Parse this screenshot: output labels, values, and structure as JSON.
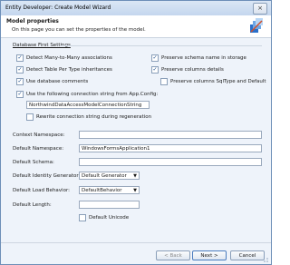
{
  "window": {
    "title": "Entity Developer: Create Model Wizard",
    "close": "×"
  },
  "header": {
    "title": "Model properties",
    "subtitle": "On this page you can set the properties of the model."
  },
  "db_first": {
    "section_label": "Database First Settings",
    "options": {
      "detect_m2m": {
        "label": "Detect Many-to-Many associations",
        "checked": true
      },
      "preserve_schema": {
        "label": "Preserve schema name in storage",
        "checked": true
      },
      "detect_tpt": {
        "label": "Detect Table Per Type inheritances",
        "checked": true
      },
      "preserve_columns": {
        "label": "Preserve columns details",
        "checked": true
      },
      "use_comments": {
        "label": "Use database comments",
        "checked": true
      },
      "preserve_sqltype": {
        "label": "Preserve columns SqlType and Default",
        "checked": false
      },
      "use_connstr": {
        "label": "Use the following connection string from App.Config:",
        "checked": true
      },
      "rewrite": {
        "label": "Rewrite connection string during regeneration",
        "checked": false
      }
    },
    "connection_string": "NorthwindDataAccessModelConnectionString"
  },
  "fields": {
    "context_namespace": {
      "label": "Context Namespace:",
      "value": ""
    },
    "default_namespace": {
      "label": "Default Namespace:",
      "value": "WindowsFormsApplication1"
    },
    "default_schema": {
      "label": "Default Schema:",
      "value": ""
    },
    "identity_generator": {
      "label": "Default Identity Generator:",
      "value": "Default Generator"
    },
    "load_behavior": {
      "label": "Default Load Behavior:",
      "value": "DefaultBehavior"
    },
    "default_length": {
      "label": "Default Length:",
      "value": ""
    },
    "default_unicode": {
      "label": "Default Unicode",
      "checked": false
    }
  },
  "buttons": {
    "back": "< Back",
    "next": "Next >",
    "cancel": "Cancel"
  },
  "colors": {
    "accent": "#4b7dbf",
    "header_bg": "#ffffff",
    "window_bg": "#eef3fa"
  }
}
